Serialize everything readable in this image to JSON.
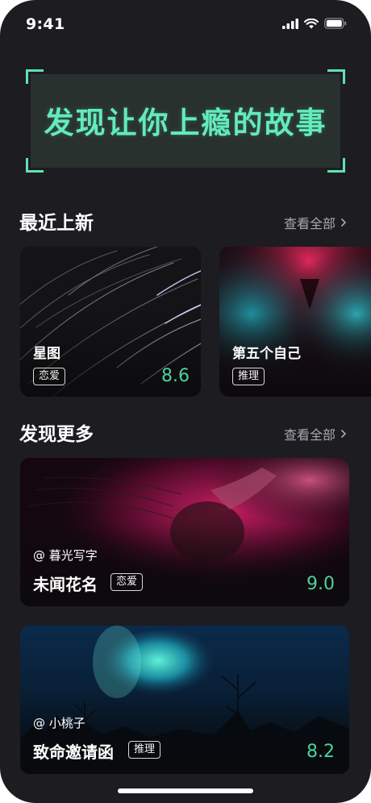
{
  "status_bar": {
    "time": "9:41"
  },
  "hero": {
    "title": "发现让你上瘾的故事"
  },
  "recent": {
    "title": "最近上新",
    "view_all": "查看全部",
    "cards": [
      {
        "title": "星图",
        "tag": "恋爱",
        "score": "8.6"
      },
      {
        "title": "第五个自己",
        "tag": "推理",
        "score": ""
      }
    ]
  },
  "discover": {
    "title": "发现更多",
    "view_all": "查看全部",
    "cards": [
      {
        "author": "@ 暮光写字",
        "title": "未闻花名",
        "tag": "恋爱",
        "score": "9.0"
      },
      {
        "author": "@ 小桃子",
        "title": "致命邀请函",
        "tag": "推理",
        "score": "8.2"
      }
    ]
  },
  "colors": {
    "accent": "#62ebbb",
    "score": "#4bd29b",
    "background": "#1c1c21"
  },
  "icons": [
    "signal-icon",
    "wifi-icon",
    "battery-icon",
    "chevron-right-icon"
  ]
}
